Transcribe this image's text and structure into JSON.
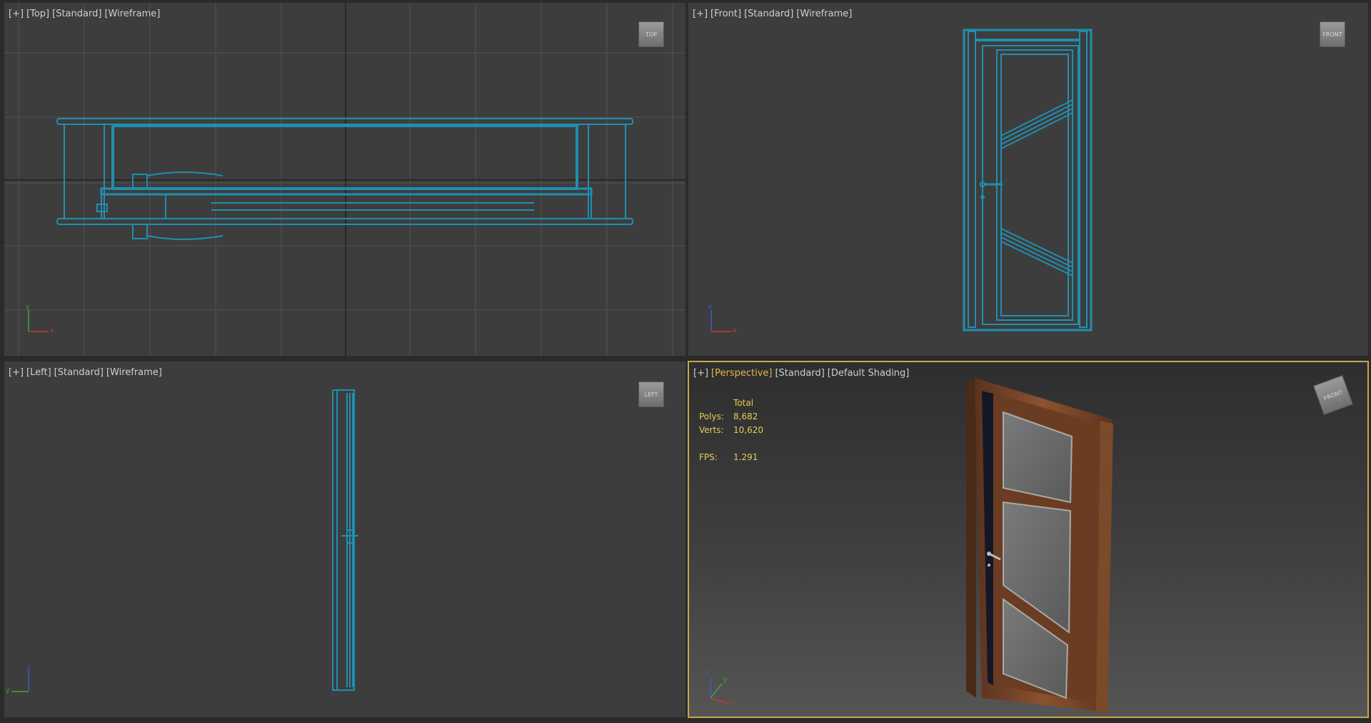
{
  "viewports": {
    "top": {
      "labels": [
        "[+]",
        "[Top]",
        "[Standard]",
        "[Wireframe]"
      ],
      "viewcube": "TOP",
      "axes": {
        "y": "y",
        "x": "x"
      }
    },
    "front": {
      "labels": [
        "[+]",
        "[Front]",
        "[Standard]",
        "[Wireframe]"
      ],
      "viewcube": "FRONT",
      "axes": {
        "y": "z",
        "x": "x"
      }
    },
    "left": {
      "labels": [
        "[+]",
        "[Left]",
        "[Standard]",
        "[Wireframe]"
      ],
      "viewcube": "LEFT",
      "axes": {
        "y": "z",
        "x": "y"
      }
    },
    "perspective": {
      "labels": [
        "[+]",
        "[Perspective]",
        "[Standard]",
        "[Default Shading]"
      ],
      "viewcube": "FRONT",
      "stats": {
        "header": "Total",
        "polys_label": "Polys:",
        "polys": "8,682",
        "verts_label": "Verts:",
        "verts": "10,620",
        "fps_label": "FPS:",
        "fps": "1.291"
      },
      "axes": {
        "y": "z",
        "x": "x",
        "z": "y"
      }
    }
  },
  "colors": {
    "wire": "#1f8fb0",
    "active_border": "#c8a64a",
    "stats_text": "#e6cc55",
    "label_text": "#cfcfcf"
  },
  "icons": [
    "viewcube-icon",
    "axis-tripod-icon"
  ]
}
